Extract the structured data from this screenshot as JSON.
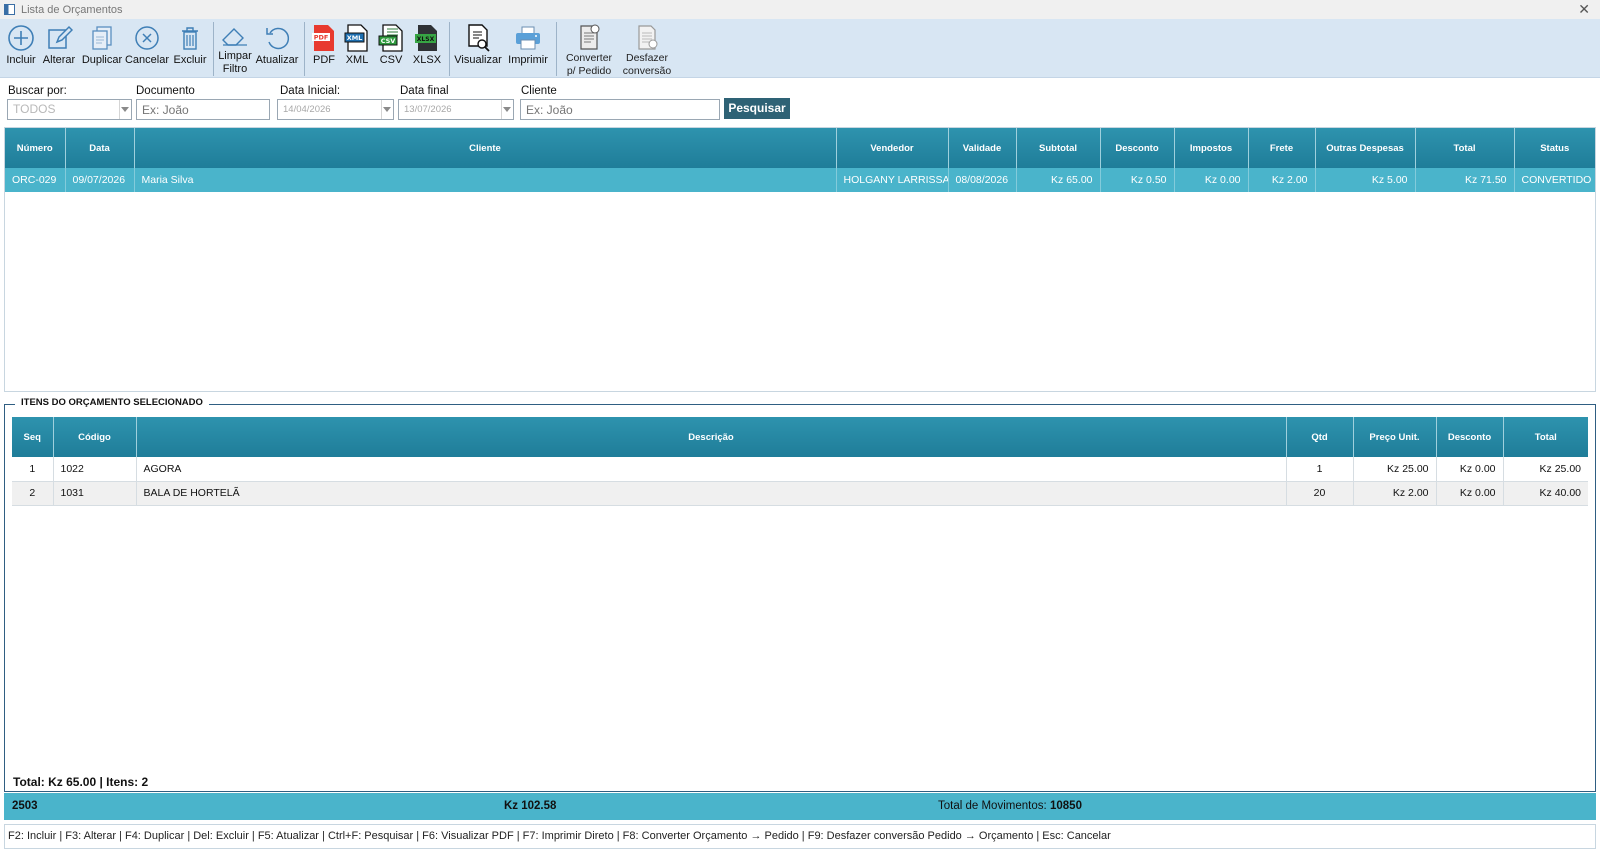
{
  "window": {
    "title": "Lista de Orçamentos",
    "close_glyph": "✕"
  },
  "toolbar": {
    "incluir": "Incluir",
    "alterar": "Alterar",
    "duplicar": "Duplicar",
    "cancelar": "Cancelar",
    "excluir": "Excluir",
    "limpar_1": "Limpar",
    "limpar_2": "Filtro",
    "atualizar": "Atualizar",
    "pdf": "PDF",
    "xml": "XML",
    "csv": "CSV",
    "xlsx": "XLSX",
    "visualizar": "Visualizar",
    "imprimir": "Imprimir",
    "converter_1": "Converter",
    "converter_2": "p/ Pedido",
    "desfazer_1": "Desfazer",
    "desfazer_2": "conversão",
    "icons": {
      "pdf_text": "PDF",
      "xml_text": "XML",
      "csv_text": "CSV",
      "xlsx_text": "XLSX"
    }
  },
  "filters": {
    "buscar_label": "Buscar por:",
    "buscar_value": "TODOS",
    "documento_label": "Documento",
    "documento_placeholder": "Ex: João",
    "data_inicial_label": "Data Inicial:",
    "data_inicial_value": "14/04/2026",
    "data_final_label": "Data final",
    "data_final_value": "13/07/2026",
    "cliente_label": "Cliente",
    "cliente_placeholder": "Ex: João",
    "pesquisar": "Pesquisar"
  },
  "orcamentos": {
    "columns": [
      "Número",
      "Data",
      "Cliente",
      "Vendedor",
      "Validade",
      "Subtotal",
      "Desconto",
      "Impostos",
      "Frete",
      "Outras Despesas",
      "Total",
      "Status"
    ],
    "rows": [
      [
        "ORC-029",
        "09/07/2026",
        "Maria Silva",
        "HOLGANY LARRISSA",
        "08/08/2026",
        "Kz 65.00",
        "Kz 0.50",
        "Kz 0.00",
        "Kz 2.00",
        "Kz 5.00",
        "Kz 71.50",
        "CONVERTIDO"
      ]
    ]
  },
  "itens": {
    "group_title": "ITENS DO ORÇAMENTO SELECIONADO",
    "columns": [
      "Seq",
      "Código",
      "Descrição",
      "Qtd",
      "Preço Unit.",
      "Desconto",
      "Total"
    ],
    "rows": [
      [
        "1",
        "1022",
        "AGORA",
        "1",
        "Kz 25.00",
        "Kz 0.00",
        "Kz 25.00"
      ],
      [
        "2",
        "1031",
        "BALA DE HORTELÃ",
        "20",
        "Kz 2.00",
        "Kz 0.00",
        "Kz 40.00"
      ]
    ],
    "total_text": "Total: Kz 65.00 | Itens: 2"
  },
  "summary": {
    "count": "2503",
    "amount": "Kz 102.58",
    "movimentos_label": "Total de Movimentos:",
    "movimentos_value": "10850"
  },
  "shortcuts": "F2: Incluir | F3: Alterar | F4: Duplicar | Del: Excluir | F5: Atualizar | Ctrl+F: Pesquisar | F6: Visualizar PDF | F7: Imprimir Direto | F8: Converter Orçamento → Pedido | F9:  Desfazer conversão Pedido → Orçamento | Esc: Cancelar"
}
